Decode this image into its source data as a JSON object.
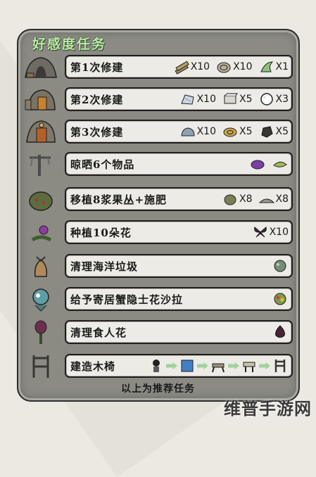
{
  "panel": {
    "title": "好感度任务",
    "footer": "以上为推荐任务"
  },
  "quests": [
    {
      "label": "第1次修建",
      "icon": "tent-camp-icon",
      "reqs": [
        {
          "icon": "boards-icon",
          "count": "X10"
        },
        {
          "icon": "rope-icon",
          "count": "X10"
        },
        {
          "icon": "kelp-icon",
          "count": "X1"
        }
      ]
    },
    {
      "label": "第2次修建",
      "icon": "tent-camp-lantern-icon",
      "reqs": [
        {
          "icon": "marble-icon",
          "count": "X10"
        },
        {
          "icon": "cut-stone-icon",
          "count": "X5"
        },
        {
          "icon": "pearl-icon",
          "count": "X3"
        }
      ]
    },
    {
      "label": "第3次修建",
      "icon": "tent-camp-large-icon",
      "reqs": [
        {
          "icon": "rocks-icon",
          "count": "X10"
        },
        {
          "icon": "gold-rope-icon",
          "count": "X5"
        },
        {
          "icon": "charcoal-icon",
          "count": "X5"
        }
      ]
    },
    {
      "label": "晾晒6个物品",
      "icon": "drying-rack-icon",
      "reqs": [
        {
          "icon": "purple-fruit-icon",
          "count": ""
        },
        {
          "icon": "dried-kelp-icon",
          "count": ""
        }
      ]
    },
    {
      "label": "移植8浆果丛+施肥",
      "icon": "berry-bush-icon",
      "reqs": [
        {
          "icon": "berry-bush-small-icon",
          "count": "X8"
        },
        {
          "icon": "fertilizer-icon",
          "count": "X8"
        }
      ]
    },
    {
      "label": "种植10朵花",
      "icon": "flower-icon",
      "reqs": [
        {
          "icon": "butterfly-icon",
          "count": "X10"
        }
      ]
    },
    {
      "label": "清理海洋垃圾",
      "icon": "sea-trash-icon",
      "reqs": [
        {
          "icon": "seaweed-clump-icon",
          "count": ""
        }
      ]
    },
    {
      "label": "给予寄居蟹隐士花沙拉",
      "icon": "hermit-crab-icon",
      "reqs": [
        {
          "icon": "flower-salad-icon",
          "count": ""
        }
      ]
    },
    {
      "label": "清理食人花",
      "icon": "lureplant-icon",
      "reqs": [
        {
          "icon": "lureplant-bulb-icon",
          "count": ""
        }
      ]
    },
    {
      "label": "建造木椅",
      "icon": "wooden-chair-icon",
      "reqs": [
        {
          "icon": "character-icon",
          "count": ""
        },
        {
          "icon": "blueprint-icon",
          "count": ""
        },
        {
          "icon": "sawhorse-icon",
          "count": ""
        },
        {
          "icon": "workbench-icon",
          "count": ""
        },
        {
          "icon": "wooden-chair-small-icon",
          "count": ""
        }
      ]
    }
  ],
  "watermark": "维普手游网"
}
